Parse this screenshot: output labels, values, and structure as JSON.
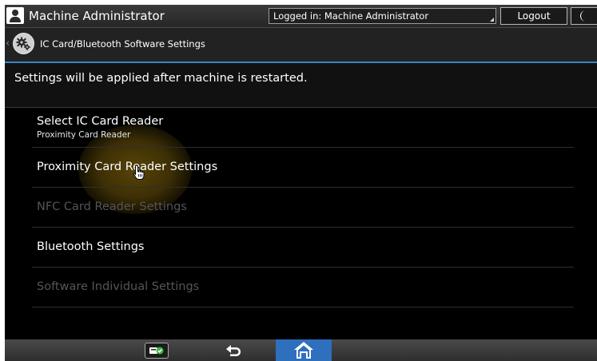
{
  "header": {
    "user_name": "Machine Administrator",
    "login_status": "Logged in: Machine Administrator",
    "logout_label": "Logout"
  },
  "breadcrumb": {
    "title": "IC Card/Bluetooth Software Settings"
  },
  "notice": "Settings will be applied after machine is restarted.",
  "menu": {
    "items": [
      {
        "label": "Select IC Card Reader",
        "sublabel": "Proximity Card Reader",
        "enabled": true
      },
      {
        "label": "Proximity Card Reader Settings",
        "enabled": true
      },
      {
        "label": "NFC Card Reader Settings",
        "enabled": false
      },
      {
        "label": "Bluetooth Settings",
        "enabled": true
      },
      {
        "label": "Software Individual Settings",
        "enabled": false
      }
    ]
  },
  "colors": {
    "accent": "#3a86c4",
    "home_button": "#2e6fbe",
    "disabled_text": "#555555",
    "touch_highlight": "#5c4808"
  },
  "icons": {
    "user": "user-icon",
    "settings": "gear-icon",
    "sleep": "moon-icon",
    "status": "check-status-icon",
    "back": "back-arrow-icon",
    "home": "home-icon"
  }
}
